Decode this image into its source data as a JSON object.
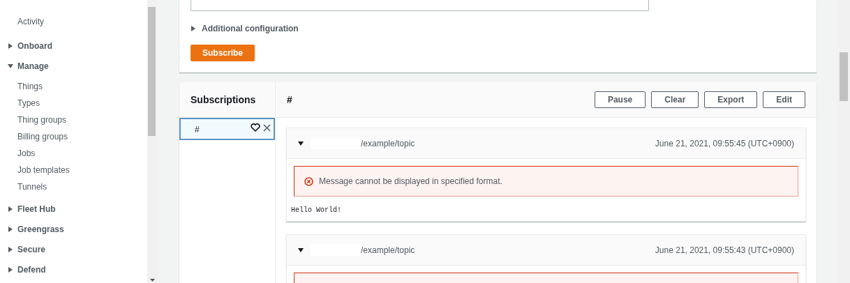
{
  "sidebar": {
    "items": [
      {
        "kind": "link",
        "label": "Activity"
      },
      {
        "kind": "section",
        "label": "Onboard",
        "expanded": false
      },
      {
        "kind": "section",
        "label": "Manage",
        "expanded": true,
        "children": [
          {
            "label": "Things"
          },
          {
            "label": "Types"
          },
          {
            "label": "Thing groups"
          },
          {
            "label": "Billing groups"
          },
          {
            "label": "Jobs"
          },
          {
            "label": "Job templates"
          },
          {
            "label": "Tunnels"
          }
        ]
      },
      {
        "kind": "section",
        "label": "Fleet Hub",
        "expanded": false
      },
      {
        "kind": "section",
        "label": "Greengrass",
        "expanded": false
      },
      {
        "kind": "section",
        "label": "Secure",
        "expanded": false
      },
      {
        "kind": "section",
        "label": "Defend",
        "expanded": false
      }
    ]
  },
  "subscribe_form": {
    "additional_configuration": {
      "label": "Additional configuration",
      "expanded": false
    },
    "subscribe_button": "Subscribe"
  },
  "subscriptions": {
    "title": "Subscriptions",
    "items": [
      {
        "topic": "#",
        "selected": true,
        "favorite": false
      }
    ]
  },
  "topic_panel": {
    "title": "#",
    "buttons": [
      "Pause",
      "Clear",
      "Export",
      "Edit"
    ],
    "messages": [
      {
        "expanded": true,
        "topic": "/example/topic",
        "time": "June 21, 2021, 09:55:45 (UTC+0900)",
        "error": "Message cannot be displayed in specified format.",
        "payload": "Hello World!"
      },
      {
        "expanded": true,
        "topic": "/example/topic",
        "time": "June 21, 2021, 09:55:43 (UTC+0900)",
        "error_box": true
      }
    ]
  }
}
